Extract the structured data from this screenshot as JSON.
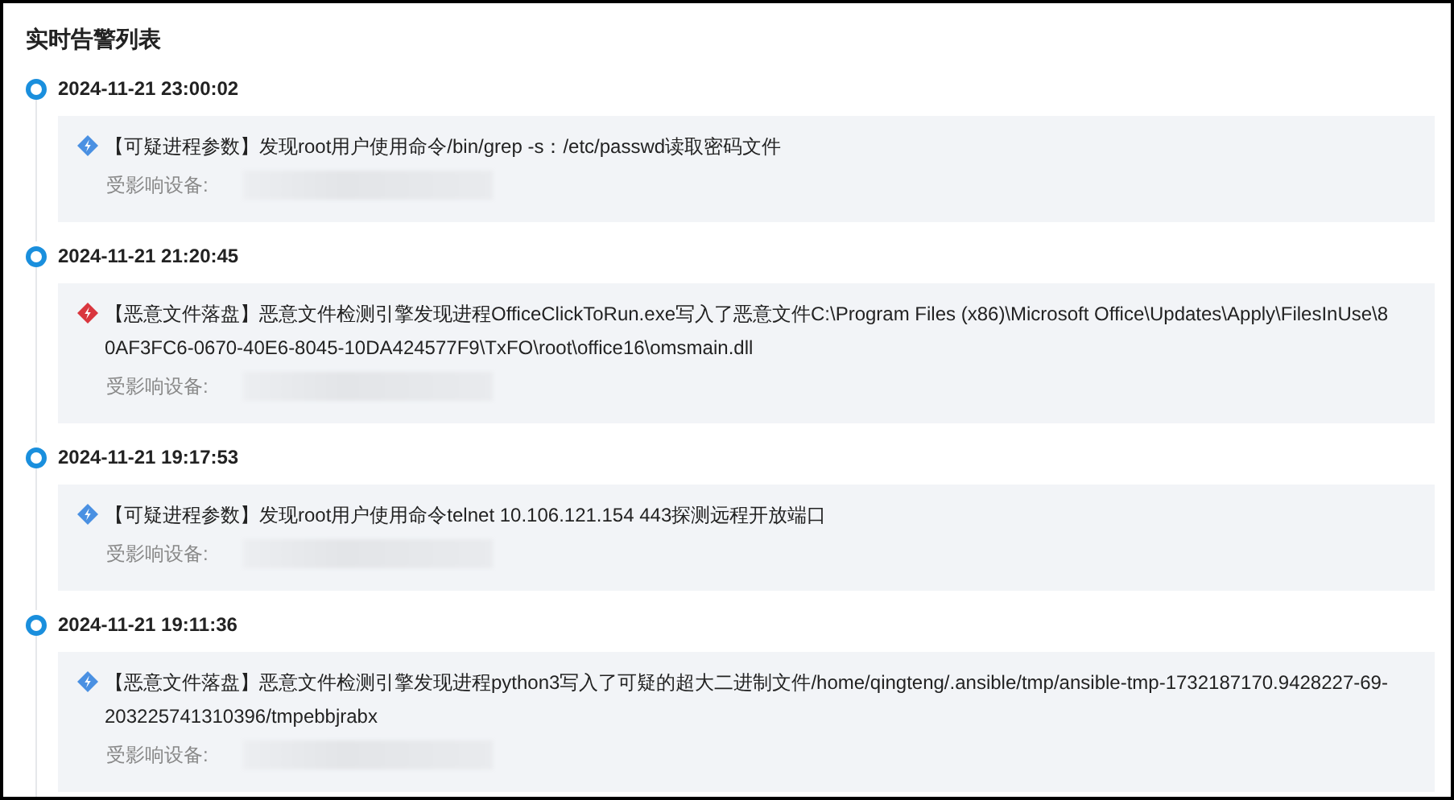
{
  "title": "实时告警列表",
  "alerts": [
    {
      "time": "2024-11-21 23:00:02",
      "color": "#4a90e2",
      "message": "【可疑进程参数】发现root用户使用命令/bin/grep -s：/etc/passwd读取密码文件",
      "device_label": "受影响设备:"
    },
    {
      "time": "2024-11-21 21:20:45",
      "color": "#d9363e",
      "message": "【恶意文件落盘】恶意文件检测引擎发现进程OfficeClickToRun.exe写入了恶意文件C:\\Program Files (x86)\\Microsoft Office\\Updates\\Apply\\FilesInUse\\80AF3FC6-0670-40E6-8045-10DA424577F9\\TxFO\\root\\office16\\omsmain.dll",
      "device_label": "受影响设备:"
    },
    {
      "time": "2024-11-21 19:17:53",
      "color": "#4a90e2",
      "message": "【可疑进程参数】发现root用户使用命令telnet 10.106.121.154 443探测远程开放端口",
      "device_label": "受影响设备:"
    },
    {
      "time": "2024-11-21 19:11:36",
      "color": "#4a90e2",
      "message": "【恶意文件落盘】恶意文件检测引擎发现进程python3写入了可疑的超大二进制文件/home/qingteng/.ansible/tmp/ansible-tmp-1732187170.9428227-69-203225741310396/tmpebbjrabx",
      "device_label": "受影响设备:"
    }
  ]
}
